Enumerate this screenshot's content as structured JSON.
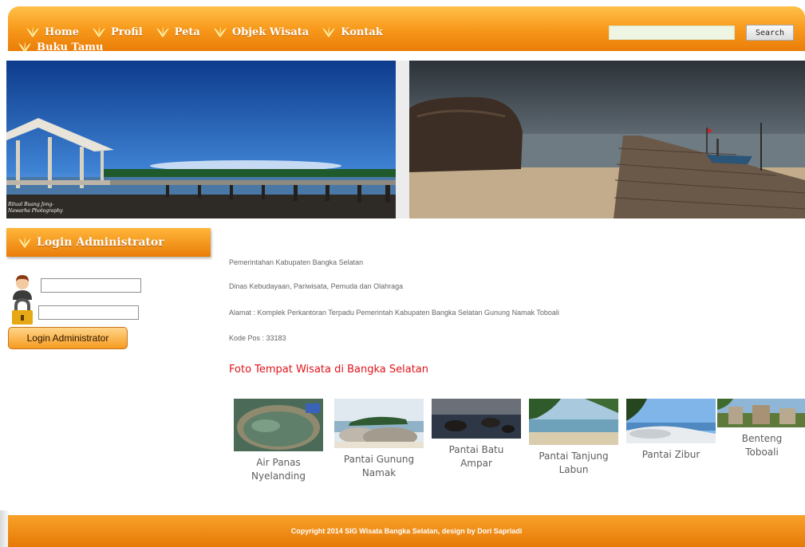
{
  "nav": {
    "items": [
      {
        "label": "Home",
        "icon": "leaf-icon"
      },
      {
        "label": "Profil",
        "icon": "leaf-icon"
      },
      {
        "label": "Peta",
        "icon": "leaf-icon"
      },
      {
        "label": "Objek Wisata",
        "icon": "leaf-icon"
      },
      {
        "label": "Kontak",
        "icon": "leaf-icon"
      }
    ],
    "overflow_item": {
      "label": "Buku Tamu",
      "icon": "leaf-icon"
    },
    "search": {
      "value": "",
      "button_label": "Search"
    }
  },
  "banner": {
    "left_caption_line1": "Ritual Buang Jong-",
    "left_caption_line2": "Nawarha Photography"
  },
  "login": {
    "title": "Login Administrator",
    "username_value": "",
    "password_value": "",
    "button_label": "Login Administrator"
  },
  "info": {
    "lines": [
      "Pemerintahan Kabupaten Bangka Selatan",
      "Dinas Kebudayaan, Pariwisata, Pemuda dan Olahraga",
      "Alamat : Komplek Perkantoran Terpadu Pemerintah Kabupaten Bangka Selatan Gunung Namak Toboali",
      "Kode Pos : 33183"
    ]
  },
  "gallery": {
    "heading": "Foto Tempat Wisata di Bangka Selatan",
    "items": [
      {
        "line1": "Air Panas",
        "line2": "Nyelanding"
      },
      {
        "line1": "Pantai Gunung",
        "line2": "Namak"
      },
      {
        "line1": "Pantai Batu",
        "line2": "Ampar"
      },
      {
        "line1": "Pantai Tanjung",
        "line2": "Labun"
      },
      {
        "line1": "Pantai Zibur",
        "line2": ""
      },
      {
        "line1": "Benteng",
        "line2": "Toboali"
      }
    ]
  },
  "footer": {
    "text": "Copyright 2014 SIG Wisata Bangka Selatan, design by Dori Sapriadi"
  },
  "colors": {
    "accent": "#f28c12",
    "heading": "#e0121a",
    "text": "#666666"
  }
}
